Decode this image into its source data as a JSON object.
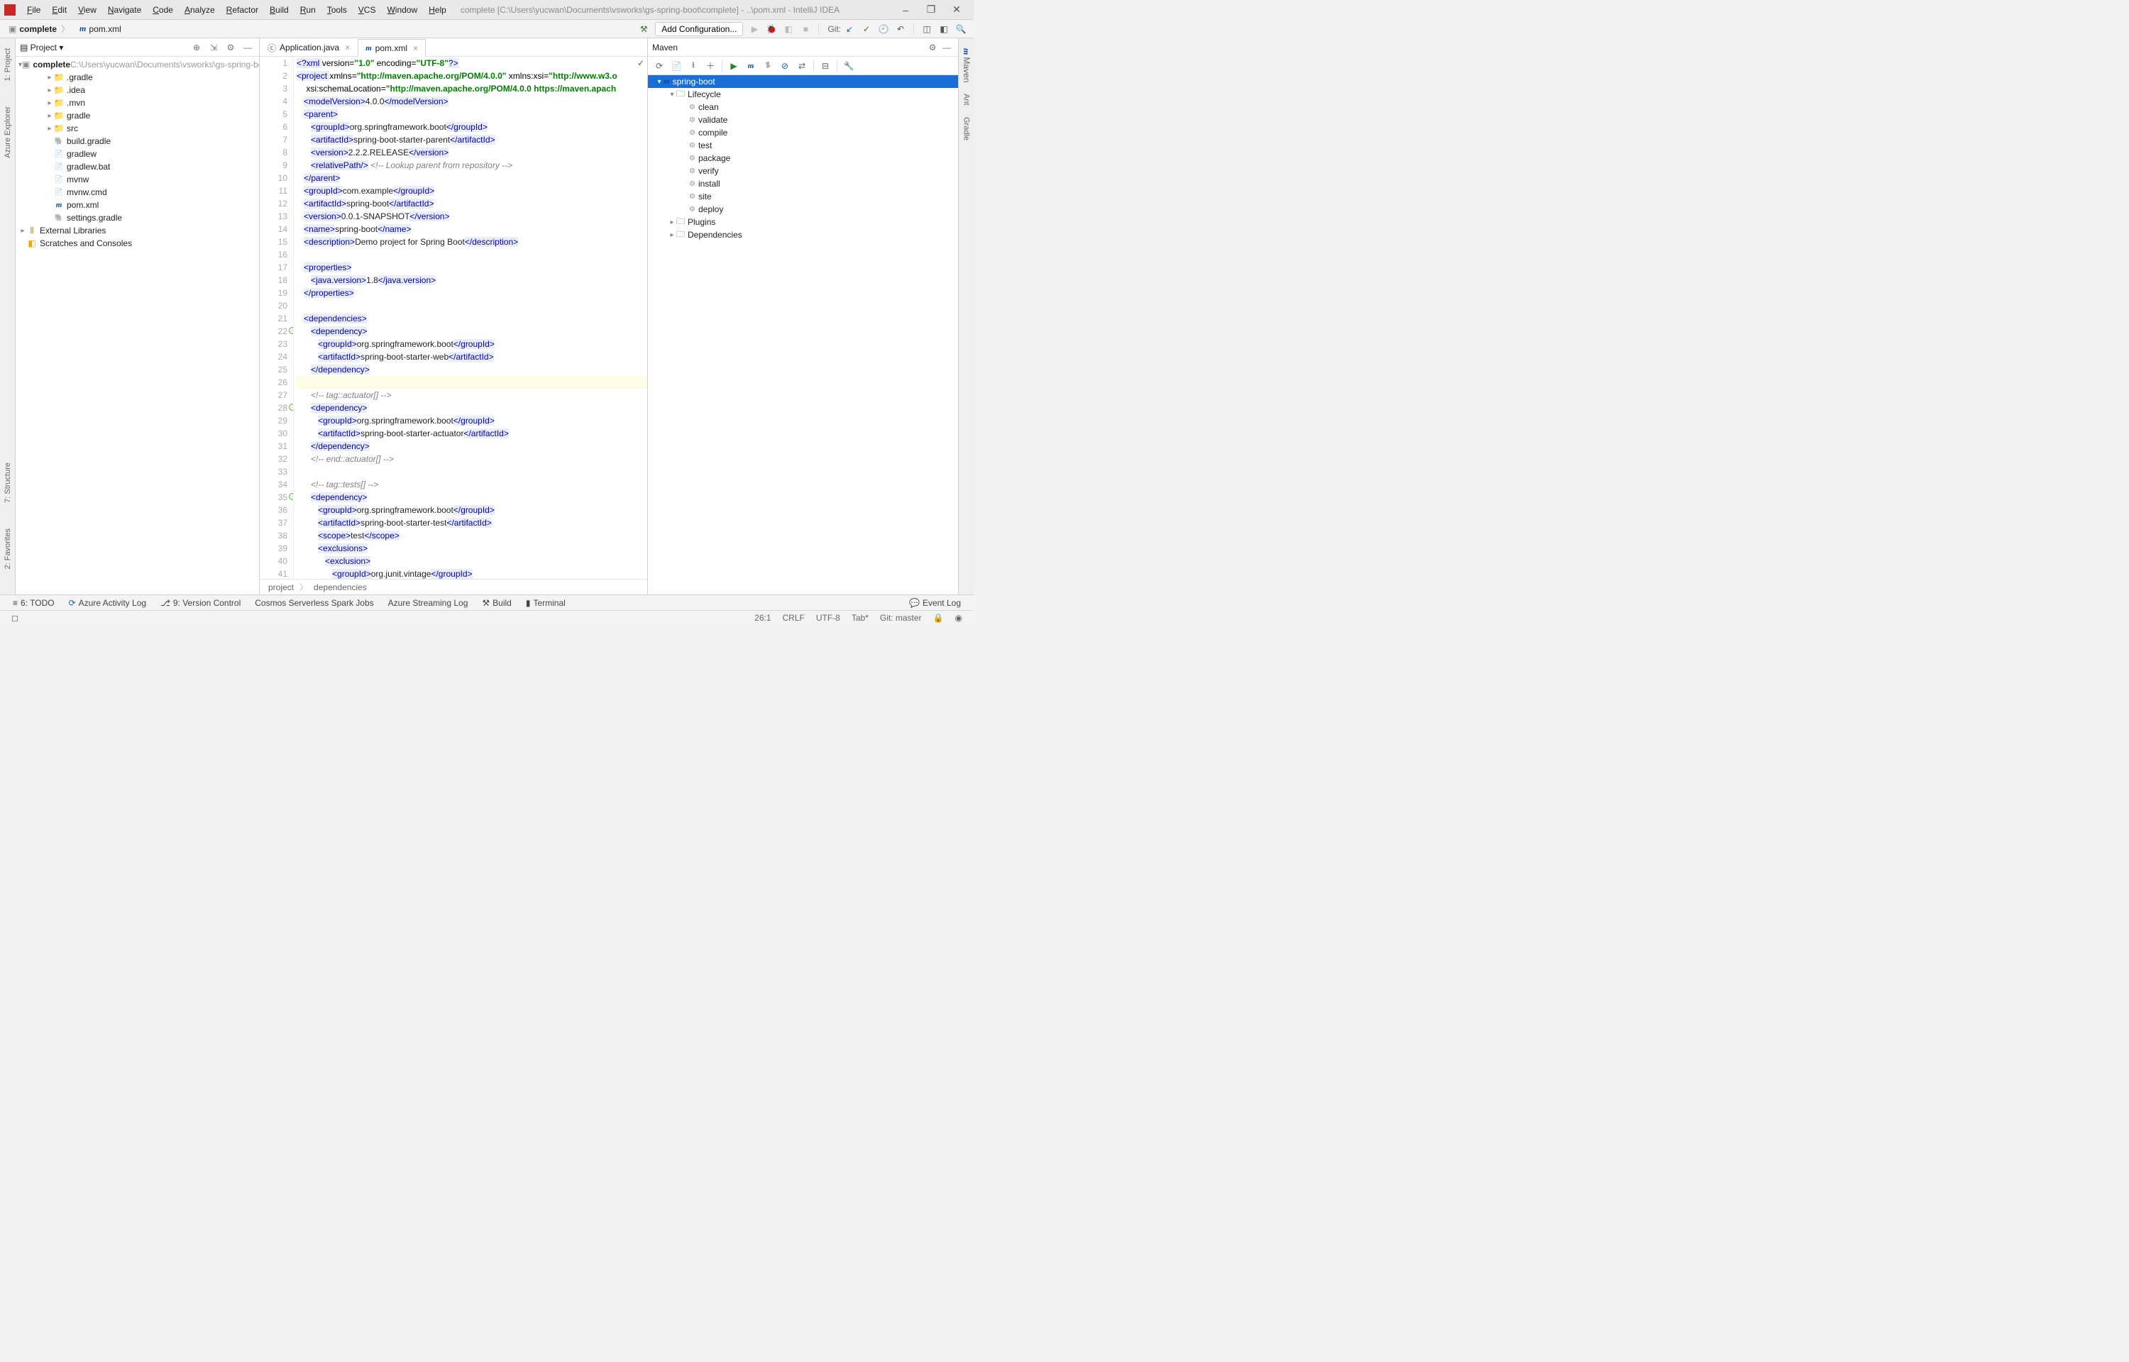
{
  "window": {
    "title": "complete [C:\\Users\\yucwan\\Documents\\vsworks\\gs-spring-boot\\complete] - ..\\pom.xml - IntelliJ IDEA",
    "menus": [
      "File",
      "Edit",
      "View",
      "Navigate",
      "Code",
      "Analyze",
      "Refactor",
      "Build",
      "Run",
      "Tools",
      "VCS",
      "Window",
      "Help"
    ]
  },
  "toolbar": {
    "crumb1": "complete",
    "crumb2": "pom.xml",
    "addConfig": "Add Configuration...",
    "git": "Git:"
  },
  "project": {
    "title": "Project",
    "root": "complete",
    "rootPath": "C:\\Users\\yucwan\\Documents\\vsworks\\gs-spring-boo",
    "children": [
      ".gradle",
      ".idea",
      ".mvn",
      "gradle",
      "src",
      "build.gradle",
      "gradlew",
      "gradlew.bat",
      "mvnw",
      "mvnw.cmd",
      "pom.xml",
      "settings.gradle"
    ],
    "extLib": "External Libraries",
    "scratch": "Scratches and Consoles"
  },
  "tabs": {
    "t1": "Application.java",
    "t2": "pom.xml"
  },
  "breadcrumb": {
    "a": "project",
    "b": "dependencies"
  },
  "maven": {
    "title": "Maven",
    "root": "spring-boot",
    "lifecycle": "Lifecycle",
    "phases": [
      "clean",
      "validate",
      "compile",
      "test",
      "package",
      "verify",
      "install",
      "site",
      "deploy"
    ],
    "plugins": "Plugins",
    "deps": "Dependencies"
  },
  "bottom": {
    "todo": "6: TODO",
    "azure": "Azure Activity Log",
    "vcs": "9: Version Control",
    "spark": "Cosmos Serverless Spark Jobs",
    "stream": "Azure Streaming Log",
    "build": "Build",
    "terminal": "Terminal",
    "evlog": "Event Log"
  },
  "status": {
    "pos": "26:1",
    "eol": "CRLF",
    "enc": "UTF-8",
    "tab": "Tab*",
    "git": "Git: master"
  },
  "sideLeft": {
    "proj": "1: Project",
    "azure": "Azure Explorer",
    "struct": "7: Structure",
    "fav": "2: Favorites"
  },
  "sideRight": {
    "maven": "Maven",
    "ant": "Ant",
    "gradle": "Gradle"
  },
  "code": {
    "lines": [
      {
        "n": 1,
        "html": "<span class='tag'>&lt;?xml </span><span class='txt'>version=</span><span class='str'>\"1.0\"</span><span class='txt'> encoding=</span><span class='str'>\"UTF-8\"</span><span class='tag'>?&gt;</span>"
      },
      {
        "n": 2,
        "html": "<span class='tag'>&lt;project </span><span class='txt'>xmlns=</span><span class='str'>\"http://maven.apache.org/POM/4.0.0\"</span><span class='txt'> xmlns:xsi=</span><span class='str'>\"http://www.w3.o</span>"
      },
      {
        "n": 3,
        "html": "    <span class='txt'>xsi:schemaLocation=</span><span class='str'>\"http://maven.apache.org/POM/4.0.0 https://maven.apach</span>"
      },
      {
        "n": 4,
        "html": "   <span class='tag'>&lt;modelVersion&gt;</span>4.0.0<span class='tag'>&lt;/modelVersion&gt;</span>"
      },
      {
        "n": 5,
        "html": "   <span class='tag'>&lt;parent&gt;</span>"
      },
      {
        "n": 6,
        "html": "      <span class='tag'>&lt;groupId&gt;</span>org.springframework.boot<span class='tag'>&lt;/groupId&gt;</span>"
      },
      {
        "n": 7,
        "html": "      <span class='tag'>&lt;artifactId&gt;</span>spring-boot-starter-parent<span class='tag'>&lt;/artifactId&gt;</span>"
      },
      {
        "n": 8,
        "html": "      <span class='tag'>&lt;version&gt;</span>2.2.2.RELEASE<span class='tag'>&lt;/version&gt;</span>"
      },
      {
        "n": 9,
        "html": "      <span class='tag'>&lt;relativePath/&gt;</span> <span class='com'>&lt;!-- Lookup parent from repository --&gt;</span>"
      },
      {
        "n": 10,
        "html": "   <span class='tag'>&lt;/parent&gt;</span>"
      },
      {
        "n": 11,
        "html": "   <span class='tag'>&lt;groupId&gt;</span>com.example<span class='tag'>&lt;/groupId&gt;</span>"
      },
      {
        "n": 12,
        "html": "   <span class='tag'>&lt;artifactId&gt;</span>spring-boot<span class='tag'>&lt;/artifactId&gt;</span>"
      },
      {
        "n": 13,
        "html": "   <span class='tag'>&lt;version&gt;</span>0.0.1-SNAPSHOT<span class='tag'>&lt;/version&gt;</span>"
      },
      {
        "n": 14,
        "html": "   <span class='tag'>&lt;name&gt;</span>spring-boot<span class='tag'>&lt;/name&gt;</span>"
      },
      {
        "n": 15,
        "html": "   <span class='tag'>&lt;description&gt;</span>Demo project for Spring Boot<span class='tag'>&lt;/description&gt;</span>"
      },
      {
        "n": 16,
        "html": ""
      },
      {
        "n": 17,
        "html": "   <span class='tag'>&lt;properties&gt;</span>"
      },
      {
        "n": 18,
        "html": "      <span class='tag'>&lt;java.version&gt;</span>1.8<span class='tag'>&lt;/java.version&gt;</span>"
      },
      {
        "n": 19,
        "html": "   <span class='tag'>&lt;/properties&gt;</span>"
      },
      {
        "n": 20,
        "html": ""
      },
      {
        "n": 21,
        "html": "   <span class='tag'>&lt;dependencies&gt;</span>"
      },
      {
        "n": 22,
        "spr": true,
        "html": "      <span class='tag'>&lt;dependency&gt;</span>"
      },
      {
        "n": 23,
        "html": "         <span class='tag'>&lt;groupId&gt;</span>org.springframework.boot<span class='tag'>&lt;/groupId&gt;</span>"
      },
      {
        "n": 24,
        "html": "         <span class='tag'>&lt;artifactId&gt;</span>spring-boot-starter-web<span class='tag'>&lt;/artifactId&gt;</span>"
      },
      {
        "n": 25,
        "html": "      <span class='tag'>&lt;/dependency&gt;</span>"
      },
      {
        "n": 26,
        "hl": true,
        "html": ""
      },
      {
        "n": 27,
        "html": "      <span class='com'>&lt;!-- tag::actuator[] --&gt;</span>"
      },
      {
        "n": 28,
        "spr": true,
        "html": "      <span class='tag'>&lt;dependency&gt;</span>"
      },
      {
        "n": 29,
        "html": "         <span class='tag'>&lt;groupId&gt;</span>org.springframework.boot<span class='tag'>&lt;/groupId&gt;</span>"
      },
      {
        "n": 30,
        "html": "         <span class='tag'>&lt;artifactId&gt;</span>spring-boot-starter-actuator<span class='tag'>&lt;/artifactId&gt;</span>"
      },
      {
        "n": 31,
        "html": "      <span class='tag'>&lt;/dependency&gt;</span>"
      },
      {
        "n": 32,
        "html": "      <span class='com'>&lt;!-- end::actuator[] --&gt;</span>"
      },
      {
        "n": 33,
        "html": ""
      },
      {
        "n": 34,
        "html": "      <span class='com'>&lt;!-- tag::tests[] --&gt;</span>"
      },
      {
        "n": 35,
        "spr": true,
        "html": "      <span class='tag'>&lt;dependency&gt;</span>"
      },
      {
        "n": 36,
        "html": "         <span class='tag'>&lt;groupId&gt;</span>org.springframework.boot<span class='tag'>&lt;/groupId&gt;</span>"
      },
      {
        "n": 37,
        "html": "         <span class='tag'>&lt;artifactId&gt;</span>spring-boot-starter-test<span class='tag'>&lt;/artifactId&gt;</span>"
      },
      {
        "n": 38,
        "html": "         <span class='tag'>&lt;scope&gt;</span>test<span class='tag'>&lt;/scope&gt;</span>"
      },
      {
        "n": 39,
        "html": "         <span class='tag'>&lt;exclusions&gt;</span>"
      },
      {
        "n": 40,
        "html": "            <span class='tag'>&lt;exclusion&gt;</span>"
      },
      {
        "n": 41,
        "html": "               <span class='tag'>&lt;groupId&gt;</span>org.junit.vintage<span class='tag'>&lt;/groupId&gt;</span>"
      }
    ]
  }
}
